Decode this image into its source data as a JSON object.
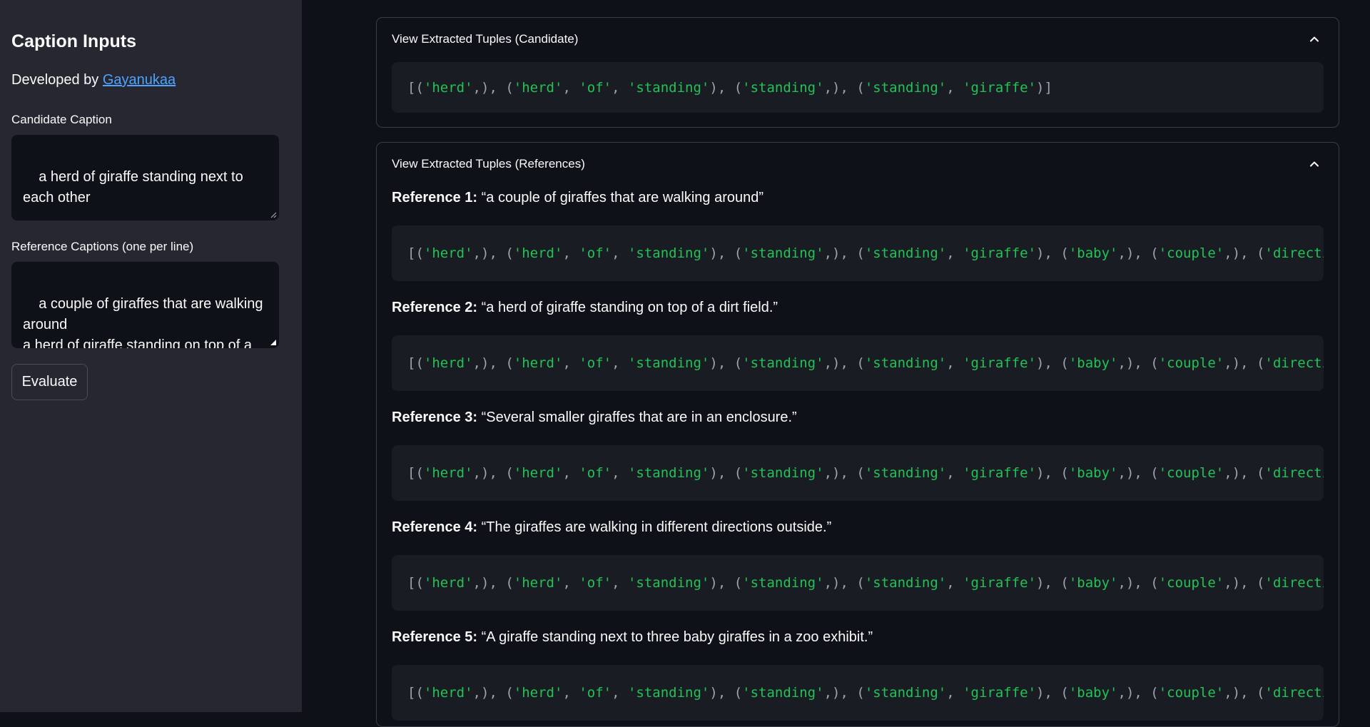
{
  "sidebar": {
    "title": "Caption Inputs",
    "developed_by_prefix": "Developed by ",
    "developer_link": "Gayanukaa",
    "candidate_label": "Candidate Caption",
    "candidate_value": "a herd of giraffe standing next to each other",
    "references_label": "Reference Captions (one per line)",
    "references_value": "a couple of giraffes that are walking around\na herd of giraffe standing on top of a dirt field.",
    "evaluate_label": "Evaluate"
  },
  "candidate_expander": {
    "header": "View Extracted Tuples (Candidate)",
    "tuples": [
      [
        "herd"
      ],
      [
        "herd",
        "of",
        "standing"
      ],
      [
        "standing"
      ],
      [
        "standing",
        "giraffe"
      ]
    ],
    "closed": true
  },
  "references_expander": {
    "header": "View Extracted Tuples (References)",
    "tuples": [
      [
        "herd"
      ],
      [
        "herd",
        "of",
        "standing"
      ],
      [
        "standing"
      ],
      [
        "standing",
        "giraffe"
      ],
      [
        "baby"
      ],
      [
        "couple"
      ],
      [
        "direction"
      ]
    ],
    "references": [
      {
        "label": "Reference 1:",
        "text": "“a couple of giraffes that are walking around”"
      },
      {
        "label": "Reference 2:",
        "text": "“a herd of giraffe standing on top of a dirt field.”"
      },
      {
        "label": "Reference 3:",
        "text": "“Several smaller giraffes that are in an enclosure.”"
      },
      {
        "label": "Reference 4:",
        "text": "“The giraffes are walking in different directions outside.”"
      },
      {
        "label": "Reference 5:",
        "text": "“A giraffe standing next to three baby giraffes in a zoo exhibit.”"
      }
    ]
  },
  "colors": {
    "accent_link": "#4da3ff",
    "string_green": "#21c354",
    "background": "#0e1117",
    "sidebar_bg": "#262730"
  }
}
